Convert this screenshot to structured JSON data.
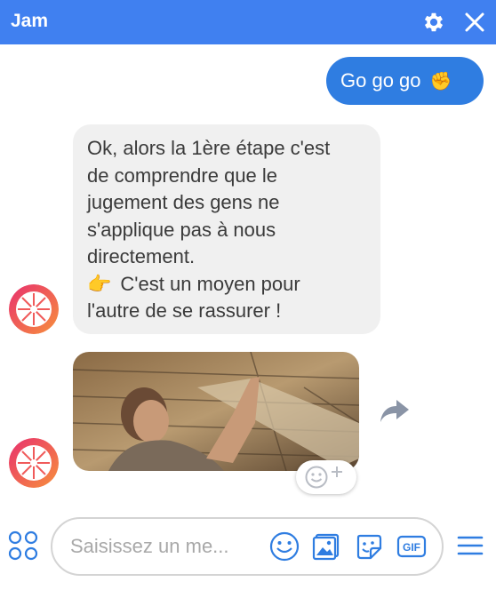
{
  "header": {
    "title": "Jam",
    "settings_icon": "gear-icon",
    "close_icon": "close-icon"
  },
  "messages": {
    "outgoing": {
      "text": "Go go go",
      "emoji": "✊"
    },
    "incoming": {
      "lines": [
        "Ok, alors la 1ère étape c'est",
        "de comprendre que le",
        "jugement des gens ne",
        "s'applique pas à nous",
        "directement.",
        "C'est un moyen pour",
        "l'autre de se rassurer !"
      ],
      "pointing_emoji": "👉"
    },
    "gif": {
      "icon": "gif-image",
      "share_icon": "share-icon",
      "react_icon": "add-reaction-icon"
    }
  },
  "composer": {
    "placeholder": "Saisissez un me...",
    "icons": [
      "apps-icon",
      "emoji-icon",
      "photo-icon",
      "sticker-icon",
      "gif-icon",
      "menu-icon"
    ]
  },
  "colors": {
    "header": "#4080f0",
    "outgoing_bubble": "#2f7de1",
    "accent": "#2f7de1"
  }
}
